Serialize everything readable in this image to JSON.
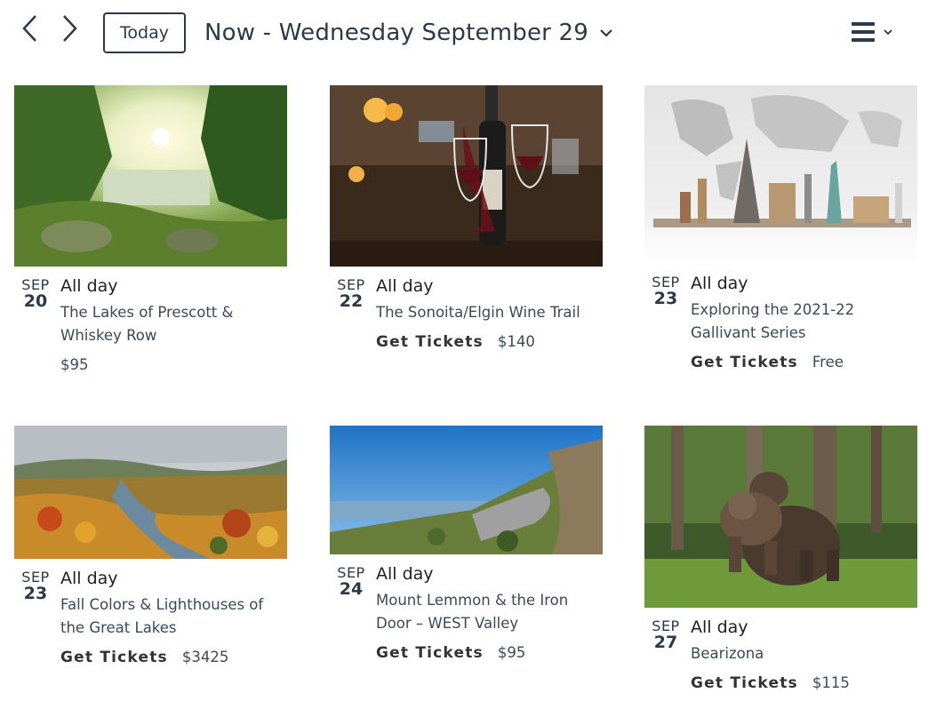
{
  "header": {
    "prev_icon": "chevron-left-icon",
    "next_icon": "chevron-right-icon",
    "today_label": "Today",
    "date_title": "Now - Wednesday September 29",
    "view_icon": "list-view-icon"
  },
  "colors": {
    "primary_text": "#2c3a48",
    "secondary_text": "#3a4a58"
  },
  "events": [
    {
      "month": "SEP",
      "day": "20",
      "time": "All day",
      "title": "The Lakes of Prescott & Whiskey Row",
      "tickets_label": "",
      "price": "$95",
      "image": "lake-forest-photo"
    },
    {
      "month": "SEP",
      "day": "22",
      "time": "All day",
      "title": "The Sonoita/Elgin Wine Trail",
      "tickets_label": "Get Tickets",
      "price": "$140",
      "image": "wine-bottle-glasses-photo"
    },
    {
      "month": "SEP",
      "day": "23",
      "time": "All day",
      "title": "Exploring the 2021-22 Gallivant Series",
      "tickets_label": "Get Tickets",
      "price": "Free",
      "image": "world-landmarks-map-photo"
    },
    {
      "month": "SEP",
      "day": "23",
      "time": "All day",
      "title": "Fall Colors & Lighthouses of the Great Lakes",
      "tickets_label": "Get Tickets",
      "price": "$3425",
      "image": "autumn-valley-photo"
    },
    {
      "month": "SEP",
      "day": "24",
      "time": "All day",
      "title": "Mount Lemmon & the Iron Door – WEST Valley",
      "tickets_label": "Get Tickets",
      "price": "$95",
      "image": "mountain-road-photo"
    },
    {
      "month": "SEP",
      "day": "27",
      "time": "All day",
      "title": "Bearizona",
      "tickets_label": "Get Tickets",
      "price": "$115",
      "image": "bears-forest-photo"
    }
  ]
}
